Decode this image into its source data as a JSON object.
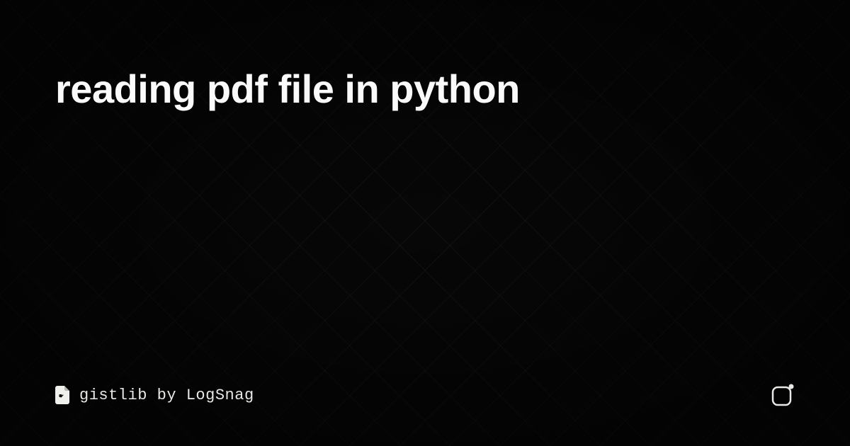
{
  "title": "reading pdf file in python",
  "footer": {
    "brand_name": "gistlib",
    "by_text": "by",
    "company": "LogSnag"
  },
  "colors": {
    "background": "#070707",
    "text_primary": "#fafafa",
    "text_secondary": "#e8e8e5"
  }
}
